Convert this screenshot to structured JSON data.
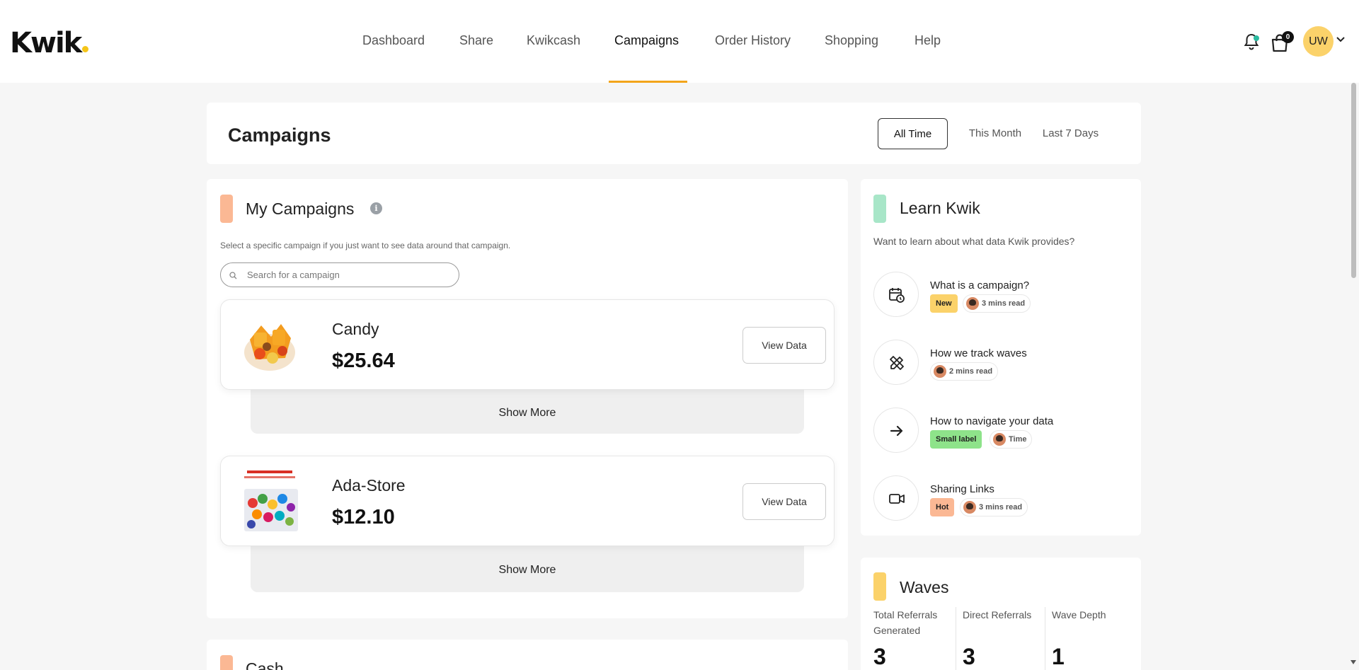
{
  "brand": {
    "logo_text": "Kwik",
    "accent": "#f5c518"
  },
  "nav": {
    "items": [
      {
        "label": "Dashboard"
      },
      {
        "label": "Share"
      },
      {
        "label": "Kwikcash"
      },
      {
        "label": "Campaigns",
        "active": true
      },
      {
        "label": "Order History"
      },
      {
        "label": "Shopping"
      },
      {
        "label": "Help"
      }
    ],
    "active_color": "#f3a51b"
  },
  "header_actions": {
    "bell_icon": "bell-icon",
    "cart_icon": "shopping-bag-icon",
    "cart_count": "0",
    "avatar_initials": "UW",
    "avatar_color": "#fbd26a"
  },
  "page": {
    "title": "Campaigns",
    "ranges": [
      {
        "label": "All Time",
        "active": true
      },
      {
        "label": "This Month"
      },
      {
        "label": "Last 7 Days"
      }
    ]
  },
  "my_campaigns": {
    "title": "My Campaigns",
    "info_icon": "i",
    "hint": "Select a specific campaign if you just want to see data around that campaign.",
    "search_placeholder": "Search for a campaign",
    "marker_color": "#fbb894",
    "items": [
      {
        "name": "Candy",
        "amount": "$25.64",
        "view_label": "View Data",
        "show_more": "Show More"
      },
      {
        "name": "Ada-Store",
        "amount": "$12.10",
        "view_label": "View Data",
        "show_more": "Show More"
      }
    ]
  },
  "cash": {
    "title": "Cash",
    "marker_color": "#fbb894"
  },
  "learn": {
    "title": "Learn Kwik",
    "marker_color": "#a8e6c8",
    "subtitle": "Want to learn about what data Kwik provides?",
    "items": [
      {
        "title": "What is a campaign?",
        "icon": "calendar-clock-icon",
        "tag": "New",
        "tag_color": "#fbd26a",
        "read": "3 mins read"
      },
      {
        "title": "How we track waves",
        "icon": "pencil-ruler-icon",
        "read": "2 mins read"
      },
      {
        "title": "How to navigate your data",
        "icon": "arrow-right-icon",
        "tag": "Small label",
        "tag_color": "#8ee38a",
        "read": "Time"
      },
      {
        "title": "Sharing Links",
        "icon": "video-icon",
        "tag": "Hot",
        "tag_color": "#fbb894",
        "read": "3 mins read"
      }
    ]
  },
  "waves": {
    "title": "Waves",
    "marker_color": "#fbd26a",
    "stats": [
      {
        "label": "Total Referrals Generated",
        "value": "3"
      },
      {
        "label": "Direct Referrals",
        "value": "3"
      },
      {
        "label": "Wave Depth",
        "value": "1"
      }
    ]
  }
}
